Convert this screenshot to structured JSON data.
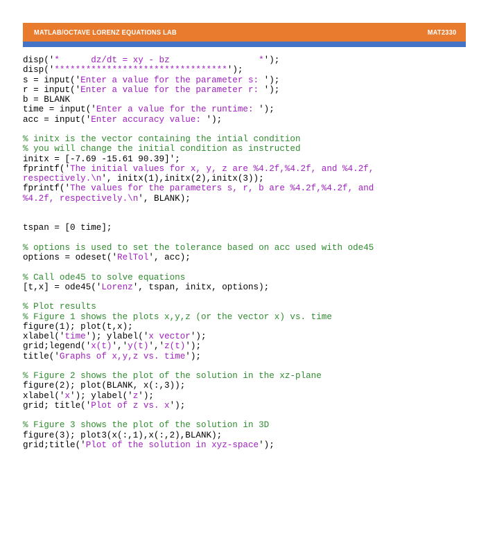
{
  "header": {
    "title": "MATLAB/OCTAVE LORENZ EQUATIONS LAB",
    "course_code": "MAT2330",
    "bar_color": "#E87B2E",
    "accent_color": "#4472C4",
    "text_color": "#FFFFFF"
  },
  "editor": {
    "language": "MATLAB/Octave",
    "colors": {
      "code": "#000000",
      "string": "#A020C0",
      "comment": "#2E8B2E",
      "background": "#FFFFFF"
    },
    "lines": [
      {
        "id": 1,
        "segments": [
          {
            "t": "code",
            "v": "disp('"
          },
          {
            "t": "string",
            "v": "*      dz/dt = xy - bz                 *"
          },
          {
            "t": "code",
            "v": "');"
          }
        ]
      },
      {
        "id": 2,
        "segments": [
          {
            "t": "code",
            "v": "disp('"
          },
          {
            "t": "string",
            "v": "*********************************"
          },
          {
            "t": "code",
            "v": "');"
          }
        ]
      },
      {
        "id": 3,
        "segments": [
          {
            "t": "code",
            "v": "s = input('"
          },
          {
            "t": "string",
            "v": "Enter a value for the parameter s: "
          },
          {
            "t": "code",
            "v": "');"
          }
        ]
      },
      {
        "id": 4,
        "segments": [
          {
            "t": "code",
            "v": "r = input('"
          },
          {
            "t": "string",
            "v": "Enter a value for the parameter r: "
          },
          {
            "t": "code",
            "v": "');"
          }
        ]
      },
      {
        "id": 5,
        "segments": [
          {
            "t": "code",
            "v": "b = BLANK"
          }
        ]
      },
      {
        "id": 6,
        "segments": [
          {
            "t": "code",
            "v": "time = input('"
          },
          {
            "t": "string",
            "v": "Enter a value for the runtime: "
          },
          {
            "t": "code",
            "v": "');"
          }
        ]
      },
      {
        "id": 7,
        "segments": [
          {
            "t": "code",
            "v": "acc = input('"
          },
          {
            "t": "string",
            "v": "Enter accuracy value: "
          },
          {
            "t": "code",
            "v": "');"
          }
        ]
      },
      {
        "id": 8,
        "segments": []
      },
      {
        "id": 9,
        "segments": [
          {
            "t": "comment",
            "v": "% initx is the vector containing the intial condition"
          }
        ]
      },
      {
        "id": 10,
        "segments": [
          {
            "t": "comment",
            "v": "% you will change the initial condition as instructed"
          }
        ]
      },
      {
        "id": 11,
        "segments": [
          {
            "t": "code",
            "v": "initx = [-7.69 -15.61 90.39]';"
          }
        ]
      },
      {
        "id": 12,
        "segments": [
          {
            "t": "code",
            "v": "fprintf('"
          },
          {
            "t": "string",
            "v": "The initial values for x, y, z are %4.2f,%4.2f, and %4.2f,"
          }
        ]
      },
      {
        "id": 13,
        "segments": [
          {
            "t": "string",
            "v": "respectively.\\n"
          },
          {
            "t": "code",
            "v": "', initx(1),initx(2),initx(3));"
          }
        ]
      },
      {
        "id": 14,
        "segments": [
          {
            "t": "code",
            "v": "fprintf('"
          },
          {
            "t": "string",
            "v": "The values for the parameters s, r, b are %4.2f,%4.2f, and"
          }
        ]
      },
      {
        "id": 15,
        "segments": [
          {
            "t": "string",
            "v": "%4.2f, respectively.\\n"
          },
          {
            "t": "code",
            "v": "', BLANK);"
          }
        ]
      },
      {
        "id": 16,
        "segments": []
      },
      {
        "id": 17,
        "segments": []
      },
      {
        "id": 18,
        "segments": [
          {
            "t": "code",
            "v": "tspan = [0 time];"
          }
        ]
      },
      {
        "id": 19,
        "segments": []
      },
      {
        "id": 20,
        "segments": [
          {
            "t": "comment",
            "v": "% options is used to set the tolerance based on acc used with ode45"
          }
        ]
      },
      {
        "id": 21,
        "segments": [
          {
            "t": "code",
            "v": "options = odeset('"
          },
          {
            "t": "string",
            "v": "RelTol"
          },
          {
            "t": "code",
            "v": "', acc);"
          }
        ]
      },
      {
        "id": 22,
        "segments": []
      },
      {
        "id": 23,
        "segments": [
          {
            "t": "comment",
            "v": "% Call ode45 to solve equations"
          }
        ]
      },
      {
        "id": 24,
        "segments": [
          {
            "t": "code",
            "v": "[t,x] = ode45('"
          },
          {
            "t": "string",
            "v": "Lorenz"
          },
          {
            "t": "code",
            "v": "', tspan, initx, options);"
          }
        ]
      },
      {
        "id": 25,
        "segments": []
      },
      {
        "id": 26,
        "segments": [
          {
            "t": "comment",
            "v": "% Plot results"
          }
        ]
      },
      {
        "id": 27,
        "segments": [
          {
            "t": "comment",
            "v": "% Figure 1 shows the plots x,y,z (or the vector x) vs. time"
          }
        ]
      },
      {
        "id": 28,
        "segments": [
          {
            "t": "code",
            "v": "figure(1); plot(t,x);"
          }
        ]
      },
      {
        "id": 29,
        "segments": [
          {
            "t": "code",
            "v": "xlabel('"
          },
          {
            "t": "string",
            "v": "time"
          },
          {
            "t": "code",
            "v": "'); ylabel('"
          },
          {
            "t": "string",
            "v": "x vector"
          },
          {
            "t": "code",
            "v": "');"
          }
        ]
      },
      {
        "id": 30,
        "segments": [
          {
            "t": "code",
            "v": "grid;legend('"
          },
          {
            "t": "string",
            "v": "x(t)"
          },
          {
            "t": "code",
            "v": "','"
          },
          {
            "t": "string",
            "v": "y(t)"
          },
          {
            "t": "code",
            "v": "','"
          },
          {
            "t": "string",
            "v": "z(t)"
          },
          {
            "t": "code",
            "v": "');"
          }
        ]
      },
      {
        "id": 31,
        "segments": [
          {
            "t": "code",
            "v": "title('"
          },
          {
            "t": "string",
            "v": "Graphs of x,y,z vs. time"
          },
          {
            "t": "code",
            "v": "');"
          }
        ]
      },
      {
        "id": 32,
        "segments": []
      },
      {
        "id": 33,
        "segments": [
          {
            "t": "comment",
            "v": "% Figure 2 shows the plot of the solution in the xz-plane"
          }
        ]
      },
      {
        "id": 34,
        "segments": [
          {
            "t": "code",
            "v": "figure(2); plot(BLANK, x(:,3));"
          }
        ]
      },
      {
        "id": 35,
        "segments": [
          {
            "t": "code",
            "v": "xlabel('"
          },
          {
            "t": "string",
            "v": "x"
          },
          {
            "t": "code",
            "v": "'); ylabel('"
          },
          {
            "t": "string",
            "v": "z"
          },
          {
            "t": "code",
            "v": "');"
          }
        ]
      },
      {
        "id": 36,
        "segments": [
          {
            "t": "code",
            "v": "grid; title('"
          },
          {
            "t": "string",
            "v": "Plot of z vs. x"
          },
          {
            "t": "code",
            "v": "');"
          }
        ]
      },
      {
        "id": 37,
        "segments": []
      },
      {
        "id": 38,
        "segments": [
          {
            "t": "comment",
            "v": "% Figure 3 shows the plot of the solution in 3D"
          }
        ]
      },
      {
        "id": 39,
        "segments": [
          {
            "t": "code",
            "v": "figure(3); plot3(x(:,1),x(:,2),BLANK);"
          }
        ]
      },
      {
        "id": 40,
        "segments": [
          {
            "t": "code",
            "v": "grid;title('"
          },
          {
            "t": "string",
            "v": "Plot of the solution in xyz-space"
          },
          {
            "t": "code",
            "v": "');"
          }
        ]
      }
    ]
  }
}
